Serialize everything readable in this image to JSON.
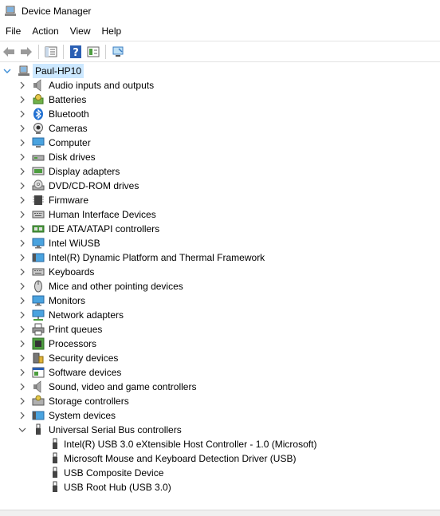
{
  "window": {
    "title": "Device Manager"
  },
  "menu": [
    "File",
    "Action",
    "View",
    "Help"
  ],
  "toolbar": [
    "back",
    "forward",
    "properties",
    "help",
    "details",
    "scan"
  ],
  "tree": {
    "root": "Paul-HP10",
    "categories": [
      {
        "label": "Audio inputs and outputs",
        "icon": "speaker-icon",
        "expanded": false
      },
      {
        "label": "Batteries",
        "icon": "battery-icon",
        "expanded": false
      },
      {
        "label": "Bluetooth",
        "icon": "bluetooth-icon",
        "expanded": false
      },
      {
        "label": "Cameras",
        "icon": "camera-icon",
        "expanded": false
      },
      {
        "label": "Computer",
        "icon": "computer-icon",
        "expanded": false
      },
      {
        "label": "Disk drives",
        "icon": "disk-drive-icon",
        "expanded": false
      },
      {
        "label": "Display adapters",
        "icon": "display-adapter-icon",
        "expanded": false
      },
      {
        "label": "DVD/CD-ROM drives",
        "icon": "dvd-drive-icon",
        "expanded": false
      },
      {
        "label": "Firmware",
        "icon": "chip-icon",
        "expanded": false
      },
      {
        "label": "Human Interface Devices",
        "icon": "keyboard-icon",
        "expanded": false
      },
      {
        "label": "IDE ATA/ATAPI controllers",
        "icon": "controller-icon",
        "expanded": false
      },
      {
        "label": "Intel WiUSB",
        "icon": "monitor-icon",
        "expanded": false
      },
      {
        "label": "Intel(R) Dynamic Platform and Thermal Framework",
        "icon": "system-device-icon",
        "expanded": false
      },
      {
        "label": "Keyboards",
        "icon": "keyboard-icon",
        "expanded": false
      },
      {
        "label": "Mice and other pointing devices",
        "icon": "mouse-icon",
        "expanded": false
      },
      {
        "label": "Monitors",
        "icon": "monitor-icon",
        "expanded": false
      },
      {
        "label": "Network adapters",
        "icon": "network-icon",
        "expanded": false
      },
      {
        "label": "Print queues",
        "icon": "printer-icon",
        "expanded": false
      },
      {
        "label": "Processors",
        "icon": "processor-icon",
        "expanded": false
      },
      {
        "label": "Security devices",
        "icon": "security-icon",
        "expanded": false
      },
      {
        "label": "Software devices",
        "icon": "software-icon",
        "expanded": false
      },
      {
        "label": "Sound, video and game controllers",
        "icon": "speaker-icon",
        "expanded": false
      },
      {
        "label": "Storage controllers",
        "icon": "storage-icon",
        "expanded": false
      },
      {
        "label": "System devices",
        "icon": "system-device-icon",
        "expanded": false
      },
      {
        "label": "Universal Serial Bus controllers",
        "icon": "usb-icon",
        "expanded": true,
        "children": [
          "Intel(R) USB 3.0 eXtensible Host Controller - 1.0 (Microsoft)",
          "Microsoft Mouse and Keyboard Detection Driver (USB)",
          "USB Composite Device",
          "USB Root Hub (USB 3.0)"
        ]
      }
    ]
  },
  "colors": {
    "selection": "#cce8ff",
    "chevron": "#555555",
    "accent": "#0078d7"
  }
}
